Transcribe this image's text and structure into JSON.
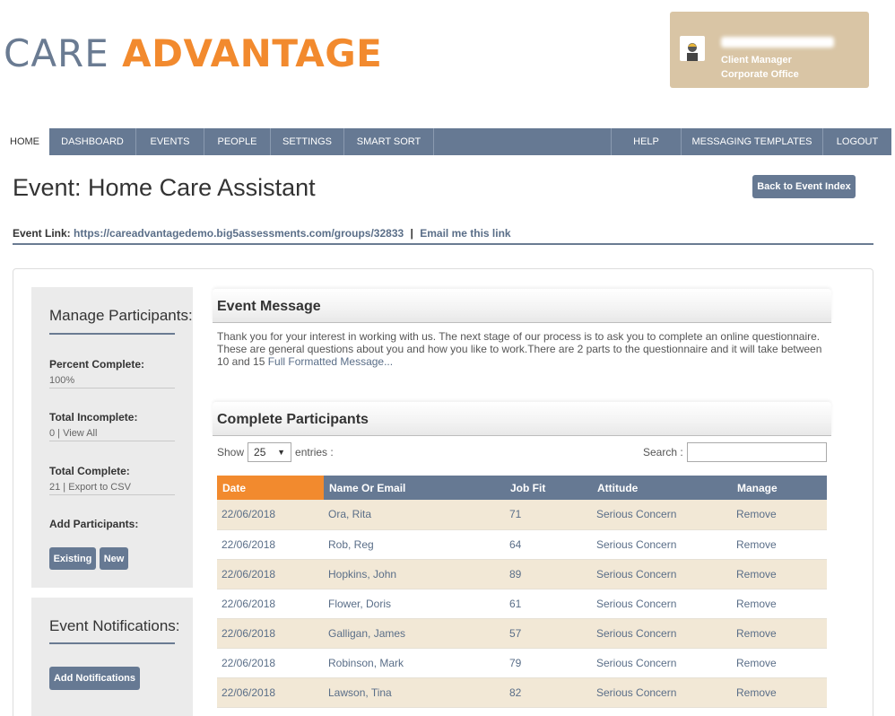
{
  "brand": {
    "word1": "CARE",
    "word2": "ADVANTAGE"
  },
  "user": {
    "role": "Client Manager",
    "office": "Corporate Office"
  },
  "nav": {
    "left": [
      "HOME",
      "DASHBOARD",
      "EVENTS",
      "PEOPLE",
      "SETTINGS",
      "SMART SORT"
    ],
    "right": [
      "HELP",
      "MESSAGING TEMPLATES",
      "LOGOUT"
    ]
  },
  "page": {
    "title": "Event: Home Care Assistant",
    "back_button": "Back to Event Index",
    "event_link_label": "Event Link:",
    "event_link_url": "https://careadvantagedemo.big5assessments.com/groups/32833",
    "email_link": "Email me this link"
  },
  "manage": {
    "title": "Manage Participants:",
    "percent_label": "Percent Complete:",
    "percent_value": "100%",
    "incomplete_label": "Total Incomplete:",
    "incomplete_count": "0",
    "incomplete_link": "View All",
    "complete_label": "Total Complete:",
    "complete_count": "21",
    "complete_link": "Export to CSV",
    "add_label": "Add Participants:",
    "existing_btn": "Existing",
    "new_btn": "New"
  },
  "notifications": {
    "title": "Event Notifications:",
    "add_btn": "Add Notifications"
  },
  "event_message": {
    "heading": "Event Message",
    "text": "Thank you for your interest in working with us. The next stage of our process is to ask you to complete an online questionnaire. These are general questions about you and how you like to work.There are 2 parts to the questionnaire and it will take between 10 and 15 ",
    "more_link": "Full Formatted Message..."
  },
  "participants": {
    "heading": "Complete Participants",
    "show_label": "Show",
    "page_size": "25",
    "entries_label": "entries :",
    "search_label": "Search :",
    "search_value": "",
    "columns": [
      "Date",
      "Name Or Email",
      "Job Fit",
      "Attitude",
      "Manage"
    ],
    "rows": [
      [
        "22/06/2018",
        "Ora, Rita",
        "71",
        "Serious Concern",
        "Remove"
      ],
      [
        "22/06/2018",
        "Rob, Reg",
        "64",
        "Serious Concern",
        "Remove"
      ],
      [
        "22/06/2018",
        "Hopkins, John",
        "89",
        "Serious Concern",
        "Remove"
      ],
      [
        "22/06/2018",
        "Flower, Doris",
        "61",
        "Serious Concern",
        "Remove"
      ],
      [
        "22/06/2018",
        "Galligan, James",
        "57",
        "Serious Concern",
        "Remove"
      ],
      [
        "22/06/2018",
        "Robinson, Mark",
        "79",
        "Serious Concern",
        "Remove"
      ],
      [
        "22/06/2018",
        "Lawson, Tina",
        "82",
        "Serious Concern",
        "Remove"
      ]
    ]
  },
  "colors": {
    "primary": "#667993",
    "accent": "#f28a2e",
    "card": "#d9c5a5",
    "row_alt": "#f2e8d6"
  }
}
